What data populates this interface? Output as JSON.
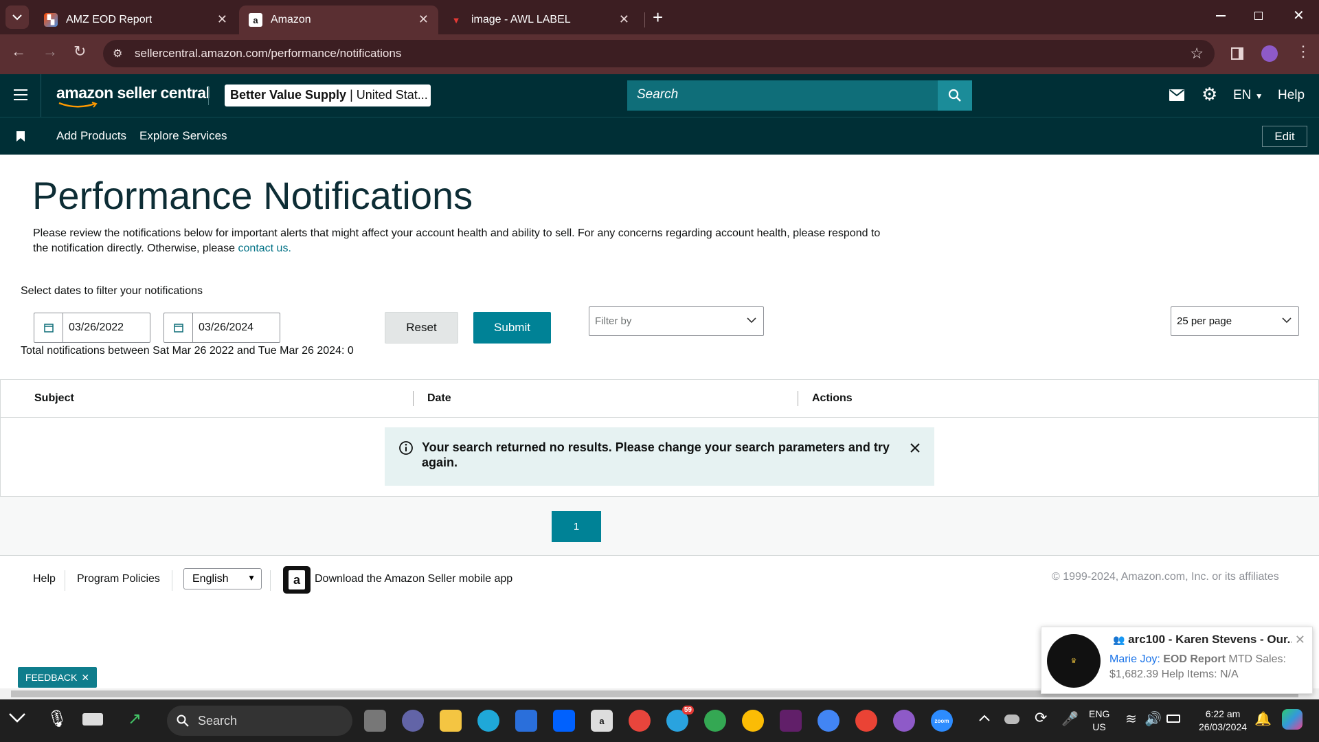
{
  "browser": {
    "tabs": [
      {
        "label": "AMZ EOD Report",
        "active": false,
        "icon": "zapier-logo-icon"
      },
      {
        "label": "Amazon",
        "active": true,
        "icon": "amazon-a-icon"
      },
      {
        "label": "image - AWL LABEL",
        "active": false,
        "icon": "awl-logo-icon"
      }
    ],
    "url": "sellercentral.amazon.com/performance/notifications"
  },
  "header": {
    "logo_text": "amazon seller central",
    "store_name": "Better Value Supply",
    "store_region": "| United Stat...",
    "search_placeholder": "Search",
    "language": "EN",
    "help": "Help"
  },
  "subnav": {
    "items": [
      "Add Products",
      "Explore Services"
    ],
    "edit": "Edit"
  },
  "page": {
    "title": "Performance Notifications",
    "description": "Please review the notifications below for important alerts that might affect your account health and ability to sell. For any concerns regarding account health, please respond to the notification directly. Otherwise, please ",
    "description_link": "contact us."
  },
  "filters": {
    "label": "Select dates to filter your notifications",
    "start_date": "03/26/2022",
    "end_date": "03/26/2024",
    "reset": "Reset",
    "submit": "Submit",
    "filter_placeholder": "Filter by",
    "per_page": "25 per page",
    "total_text": "Total notifications between Sat Mar 26 2022 and Tue Mar 26 2024: 0"
  },
  "table": {
    "columns": [
      "Subject",
      "Date",
      "Actions"
    ],
    "empty_message": "Your search returned no results. Please change your search parameters and try again."
  },
  "pagination": {
    "current_page": "1"
  },
  "footer": {
    "help": "Help",
    "program_policies": "Program Policies",
    "language": "English",
    "app_promo": "Download the Amazon Seller mobile app",
    "copyright": "© 1999-2024, Amazon.com, Inc. or its affiliates"
  },
  "feedback": "FEEDBACK",
  "toast": {
    "title": "arc100 - Karen Stevens - Our...",
    "sender": "Marie Joy:",
    "bold": "EOD Report",
    "text": " MTD Sales: $1,682.39 Help Items: N/A"
  },
  "taskbar": {
    "search": "Search",
    "lang_top": "ENG",
    "lang_bottom": "US",
    "time": "6:22 am",
    "date": "26/03/2024",
    "telegram_badge": "59"
  },
  "colors": {
    "amazon_header": "#002f36",
    "accent_teal": "#008296",
    "browser_frame": "#3c1e22"
  }
}
